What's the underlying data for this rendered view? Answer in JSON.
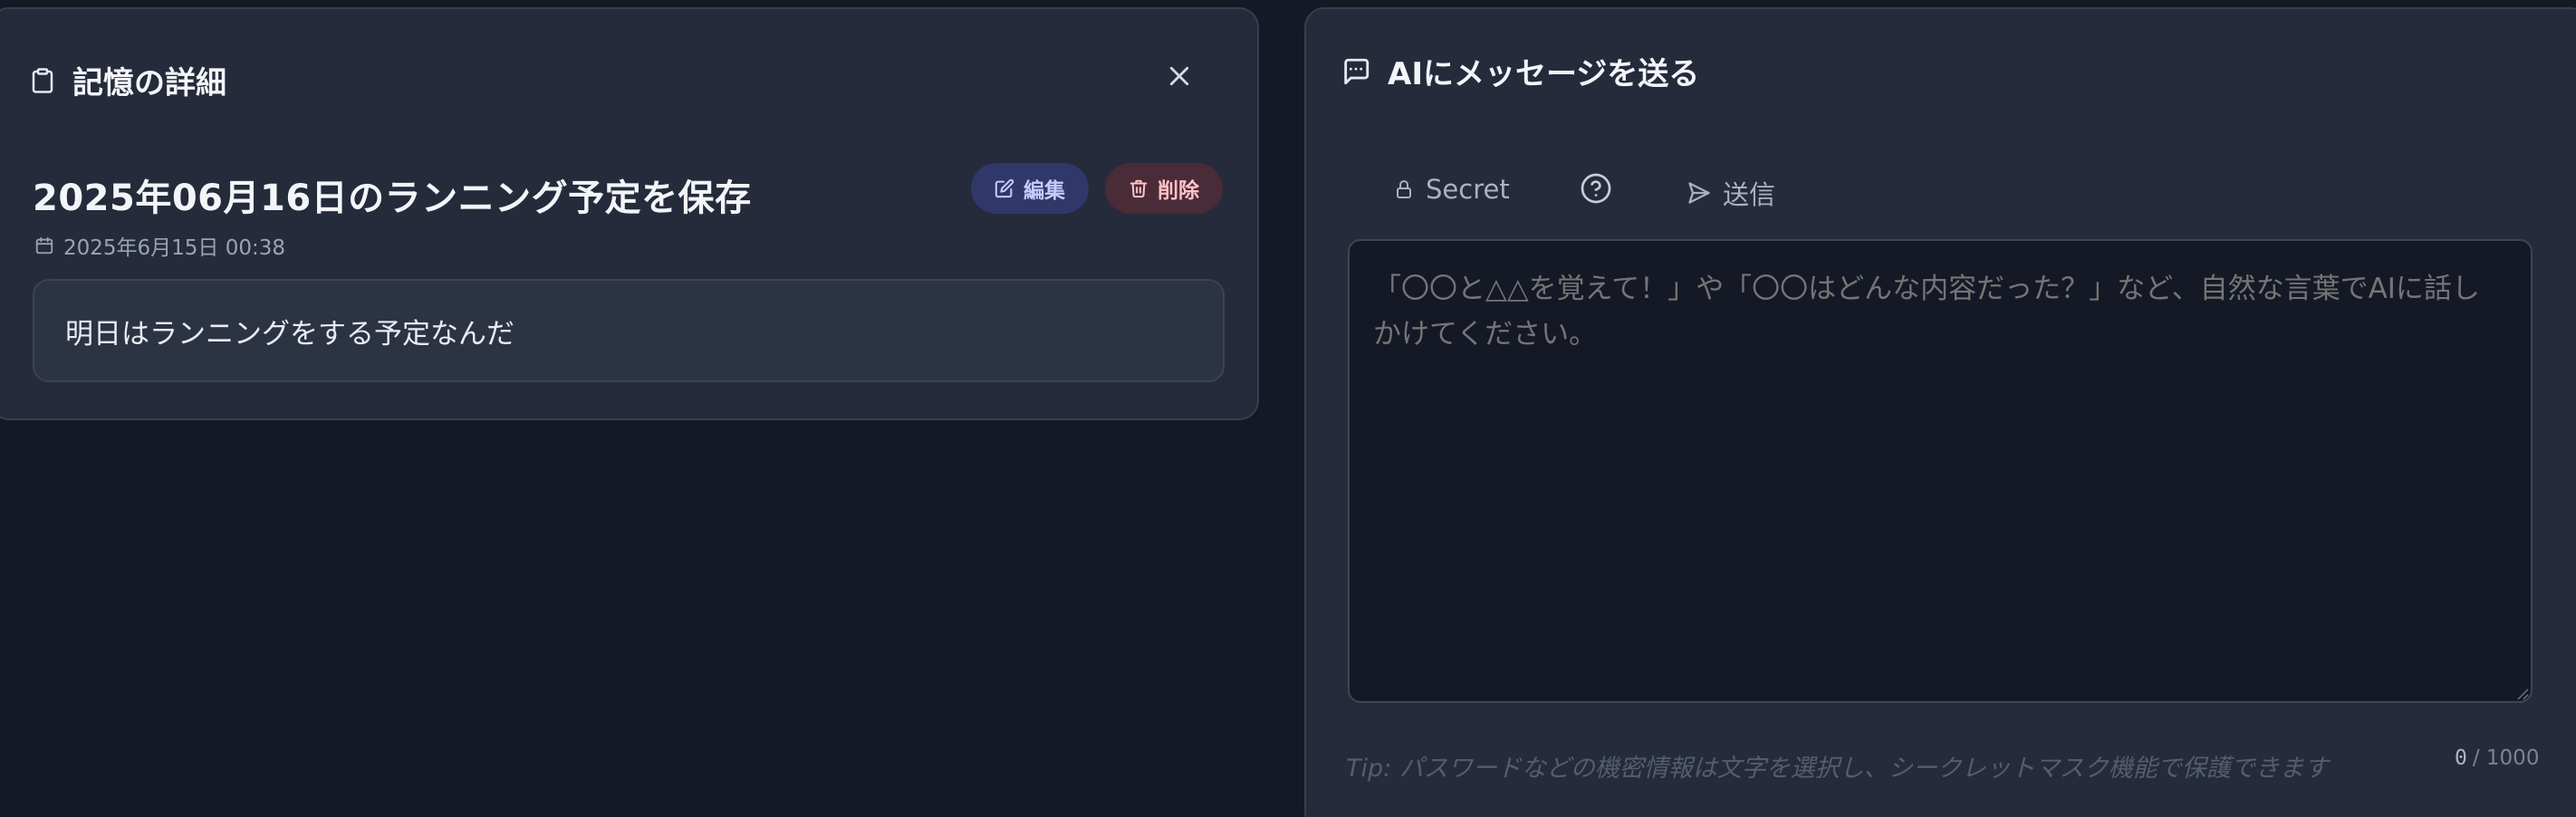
{
  "memory_detail": {
    "header_title": "記憶の詳細",
    "memory_title": "2025年06月16日のランニング予定を保存",
    "date": "2025年6月15日 00:38",
    "edit_label": "編集",
    "delete_label": "削除",
    "content": "明日はランニングをする予定なんだ"
  },
  "message_panel": {
    "header_title": "AIにメッセージを送る",
    "secret_label": "Secret",
    "send_label": "送信",
    "placeholder": "「〇〇と△△を覚えて！」や「〇〇はどんな内容だった？」など、自然な言葉でAIに話しかけてください。",
    "tip": "Tip: パスワードなどの機密情報は文字を選択し、シークレットマスク機能で保護できます",
    "char_count": "0",
    "char_limit": "/ 1000"
  },
  "icons": {
    "clipboard": "clipboard-icon",
    "close": "close-icon",
    "calendar": "calendar-icon",
    "edit": "edit-icon",
    "trash": "trash-icon",
    "chat": "chat-icon",
    "lock": "lock-icon",
    "help": "help-circle-icon",
    "send": "send-icon"
  },
  "colors": {
    "background": "#141925",
    "panel": "#252b3a",
    "edit_pill": "#30386a",
    "delete_pill": "#4a2b38"
  }
}
